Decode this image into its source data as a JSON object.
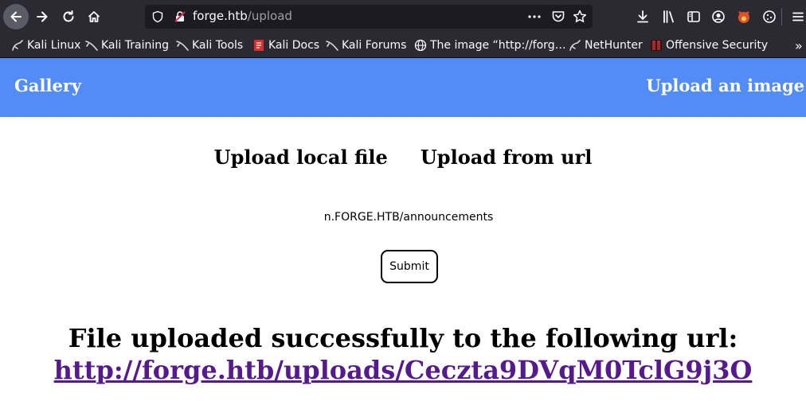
{
  "browser": {
    "url_host": "forge.htb",
    "url_path": "/upload",
    "bookmarks": [
      {
        "label": "Kali Linux",
        "icon": "kali-dragon-icon"
      },
      {
        "label": "Kali Training",
        "icon": "kali-dragon-icon"
      },
      {
        "label": "Kali Tools",
        "icon": "kali-dragon-icon"
      },
      {
        "label": "Kali Docs",
        "icon": "kali-docs-icon"
      },
      {
        "label": "Kali Forums",
        "icon": "kali-dragon-icon"
      },
      {
        "label": "The image “http://forg…",
        "icon": "globe-icon"
      },
      {
        "label": "NetHunter",
        "icon": "kali-dragon-icon"
      },
      {
        "label": "Offensive Security",
        "icon": "offsec-icon"
      }
    ],
    "overflow_label": "»"
  },
  "navbar": {
    "brand": "Gallery",
    "upload_link": "Upload an image"
  },
  "upload": {
    "tab_local": "Upload local file",
    "tab_url": "Upload from url",
    "url_value": "n.FORGE.HTB/announcements",
    "submit_label": "Submit"
  },
  "result": {
    "message": "File uploaded successfully to the following url:",
    "link": "http://forge.htb/uploads/Ceczta9DVqM0TclG9j3O"
  },
  "colors": {
    "navbar_bg": "#528cf6",
    "link": "#551a8b",
    "chrome_bg": "#2b2a33"
  }
}
